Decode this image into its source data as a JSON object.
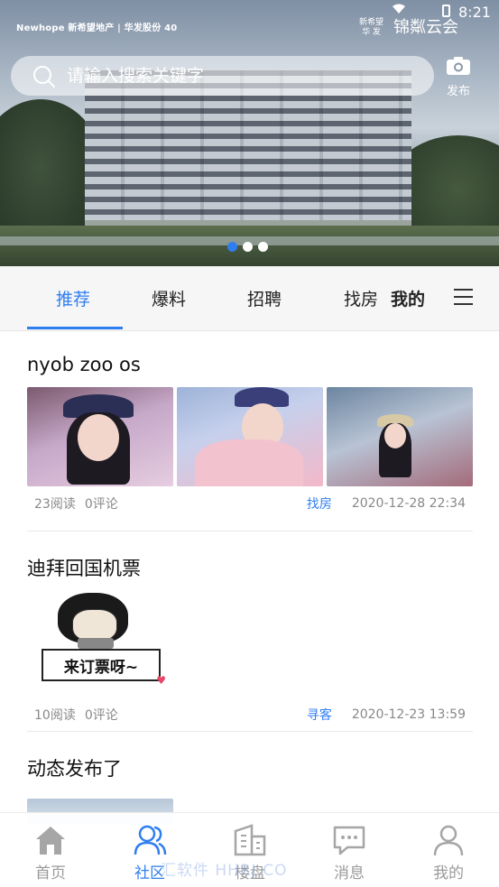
{
  "status_bar": {
    "time": "8:21"
  },
  "brand": {
    "logo_text": "Newhope 新希望地产 | 华发股份 40",
    "sub_line1": "新希望",
    "sub_line2": "华 发",
    "project_name": "锦粼云会"
  },
  "search": {
    "placeholder": "请输入搜索关键字"
  },
  "publish": {
    "label": "发布"
  },
  "carousel": {
    "total": 3,
    "active_index": 0
  },
  "tabs": [
    {
      "label": "推荐",
      "active": true
    },
    {
      "label": "爆料",
      "active": false
    },
    {
      "label": "招聘",
      "active": false
    },
    {
      "label": "找房",
      "active": false
    },
    {
      "label": "我的",
      "active": false
    }
  ],
  "posts": [
    {
      "title": "nyob zoo os",
      "reads": "23阅读",
      "comments": "0评论",
      "tag": "找房",
      "time": "2020-12-28 22:34"
    },
    {
      "title": "迪拜回国机票",
      "sticker_text": "来订票呀~",
      "reads": "10阅读",
      "comments": "0评论",
      "tag": "寻客",
      "time": "2020-12-23 13:59"
    },
    {
      "title": "动态发布了"
    }
  ],
  "bottom_nav": [
    {
      "label": "首页",
      "icon": "home-icon",
      "active": false
    },
    {
      "label": "社区",
      "icon": "community-icon",
      "active": true
    },
    {
      "label": "楼盘",
      "icon": "building-icon",
      "active": false
    },
    {
      "label": "消息",
      "icon": "message-icon",
      "active": false
    },
    {
      "label": "我的",
      "icon": "profile-icon",
      "active": false
    }
  ],
  "watermark": "汇软件 HHRJ.CO",
  "colors": {
    "accent": "#2f7ef0",
    "inactive": "#9a9a9a"
  }
}
